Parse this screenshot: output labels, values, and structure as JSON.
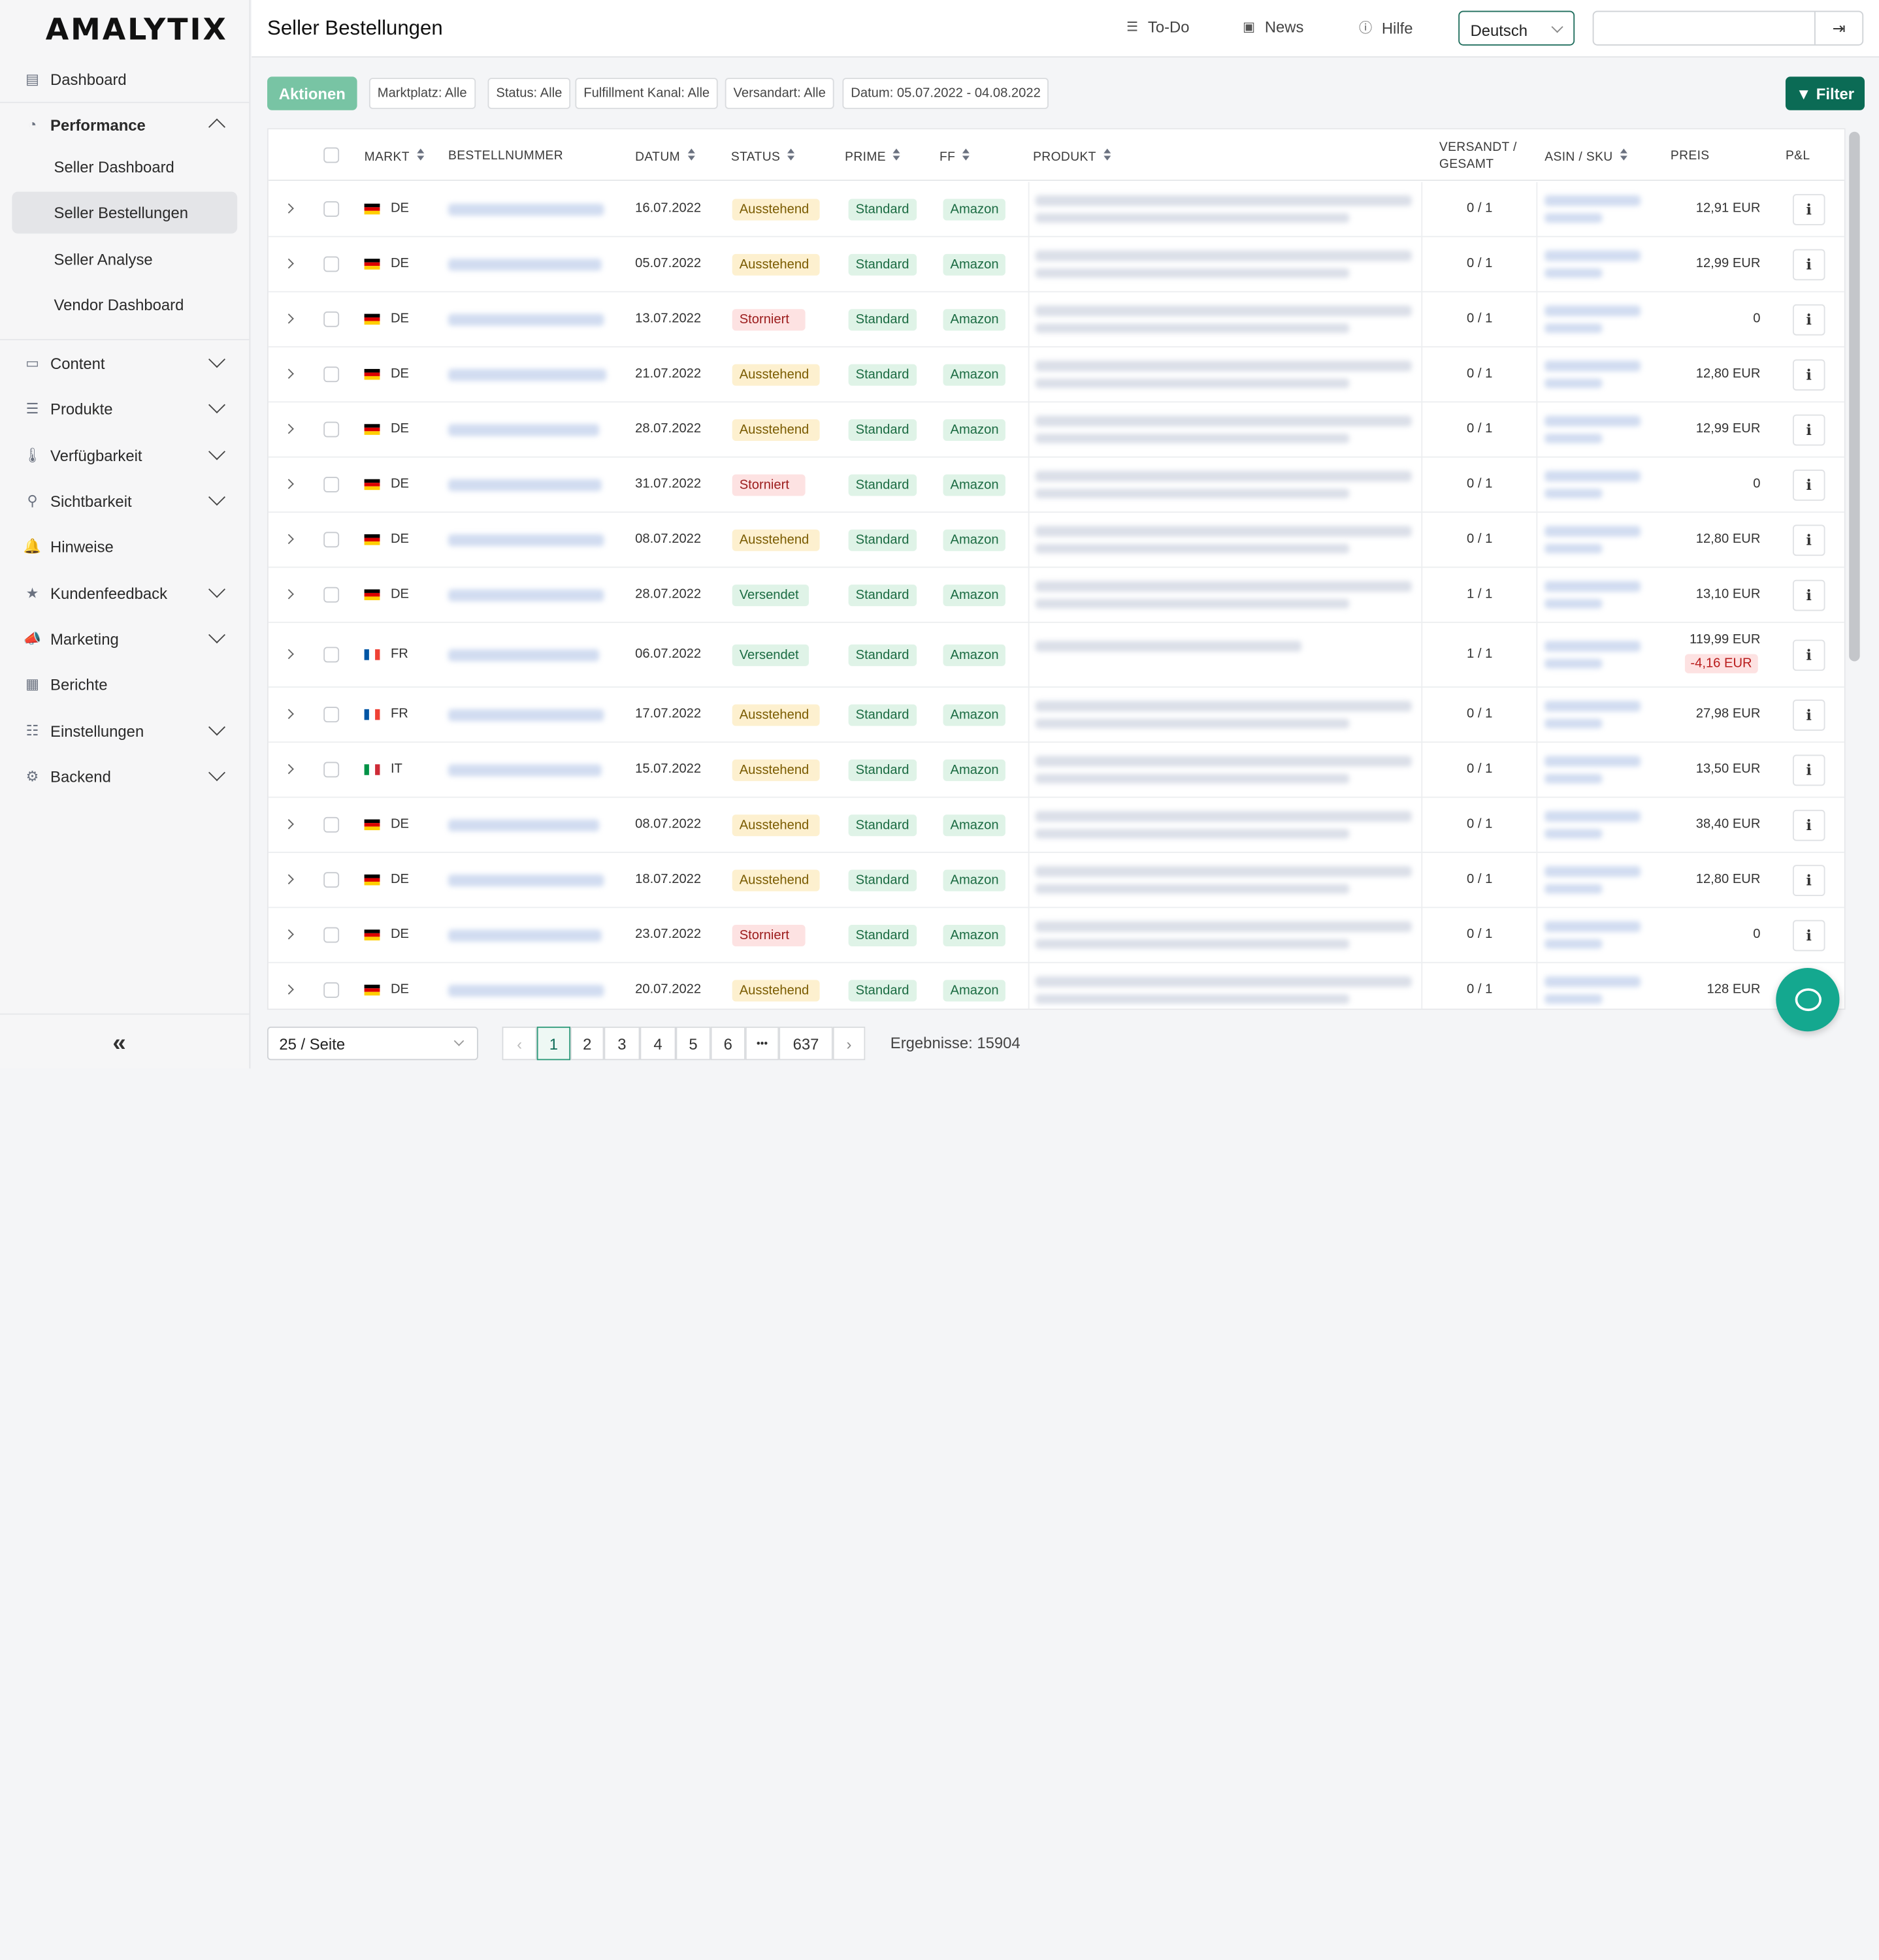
{
  "app": {
    "logo": "AMALYTIX"
  },
  "sidebar": {
    "items": [
      {
        "label": "Dashboard",
        "icon": "dashboard-icon"
      },
      {
        "label": "Performance",
        "icon": "performance-icon"
      },
      {
        "label": "Content",
        "icon": "content-icon"
      },
      {
        "label": "Produkte",
        "icon": "list-icon"
      },
      {
        "label": "Verfügbarkeit",
        "icon": "thermometer-icon"
      },
      {
        "label": "Sichtbarkeit",
        "icon": "search-icon"
      },
      {
        "label": "Hinweise",
        "icon": "bell-icon"
      },
      {
        "label": "Kundenfeedback",
        "icon": "star-icon"
      },
      {
        "label": "Marketing",
        "icon": "megaphone-icon"
      },
      {
        "label": "Berichte",
        "icon": "table-icon"
      },
      {
        "label": "Einstellungen",
        "icon": "sliders-icon"
      },
      {
        "label": "Backend",
        "icon": "gears-icon"
      }
    ],
    "performance_sub": [
      "Seller Dashboard",
      "Seller Bestellungen",
      "Seller Analyse",
      "Vendor Dashboard"
    ],
    "collapse": "«"
  },
  "header": {
    "title": "Seller Bestellungen",
    "todo": "To-Do",
    "news": "News",
    "help": "Hilfe",
    "language": "Deutsch",
    "search_value": ""
  },
  "toolbar": {
    "actions": "Aktionen",
    "chips": [
      "Marktplatz: Alle",
      "Status: Alle",
      "Fulfillment Kanal: Alle",
      "Versandart: Alle",
      "Datum: 05.07.2022 - 04.08.2022"
    ],
    "filter": "Filter"
  },
  "table": {
    "headers": {
      "markt": "MARKT",
      "bestellnummer": "BESTELLNUMMER",
      "datum": "DATUM",
      "status": "STATUS",
      "prime": "PRIME",
      "ff": "FF",
      "produkt": "PRODUKT",
      "versandt_1": "VERSANDT /",
      "versandt_2": "GESAMT",
      "asin": "ASIN / SKU",
      "preis": "PREIS",
      "pl": "P&L"
    },
    "rows": [
      {
        "markt": "DE",
        "datum": "16.07.2022",
        "status": "Ausstehend",
        "prime": "Standard",
        "ff": "Amazon",
        "versandt": "0 / 1",
        "preis": "12,91 EUR",
        "pl_icon": "i"
      },
      {
        "markt": "DE",
        "datum": "05.07.2022",
        "status": "Ausstehend",
        "prime": "Standard",
        "ff": "Amazon",
        "versandt": "0 / 1",
        "preis": "12,99 EUR",
        "pl_icon": "i"
      },
      {
        "markt": "DE",
        "datum": "13.07.2022",
        "status": "Storniert",
        "prime": "Standard",
        "ff": "Amazon",
        "versandt": "0 / 1",
        "preis": "0",
        "pl_icon": "i"
      },
      {
        "markt": "DE",
        "datum": "21.07.2022",
        "status": "Ausstehend",
        "prime": "Standard",
        "ff": "Amazon",
        "versandt": "0 / 1",
        "preis": "12,80 EUR",
        "pl_icon": "i"
      },
      {
        "markt": "DE",
        "datum": "28.07.2022",
        "status": "Ausstehend",
        "prime": "Standard",
        "ff": "Amazon",
        "versandt": "0 / 1",
        "preis": "12,99 EUR",
        "pl_icon": "i"
      },
      {
        "markt": "DE",
        "datum": "31.07.2022",
        "status": "Storniert",
        "prime": "Standard",
        "ff": "Amazon",
        "versandt": "0 / 1",
        "preis": "0",
        "pl_icon": "i"
      },
      {
        "markt": "DE",
        "datum": "08.07.2022",
        "status": "Ausstehend",
        "prime": "Standard",
        "ff": "Amazon",
        "versandt": "0 / 1",
        "preis": "12,80 EUR",
        "pl_icon": "i"
      },
      {
        "markt": "DE",
        "datum": "28.07.2022",
        "status": "Versendet",
        "prime": "Standard",
        "ff": "Amazon",
        "versandt": "1 / 1",
        "preis": "13,10 EUR",
        "pl_icon": "i"
      },
      {
        "markt": "FR",
        "datum": "06.07.2022",
        "status": "Versendet",
        "prime": "Standard",
        "ff": "Amazon",
        "versandt": "1 / 1",
        "preis": "119,99 EUR",
        "preis_neg": "-4,16 EUR",
        "pl_icon": "i"
      },
      {
        "markt": "FR",
        "datum": "17.07.2022",
        "status": "Ausstehend",
        "prime": "Standard",
        "ff": "Amazon",
        "versandt": "0 / 1",
        "preis": "27,98 EUR",
        "pl_icon": "i"
      },
      {
        "markt": "IT",
        "datum": "15.07.2022",
        "status": "Ausstehend",
        "prime": "Standard",
        "ff": "Amazon",
        "versandt": "0 / 1",
        "preis": "13,50 EUR",
        "pl_icon": "i"
      },
      {
        "markt": "DE",
        "datum": "08.07.2022",
        "status": "Ausstehend",
        "prime": "Standard",
        "ff": "Amazon",
        "versandt": "0 / 1",
        "preis": "38,40 EUR",
        "pl_icon": "i"
      },
      {
        "markt": "DE",
        "datum": "18.07.2022",
        "status": "Ausstehend",
        "prime": "Standard",
        "ff": "Amazon",
        "versandt": "0 / 1",
        "preis": "12,80 EUR",
        "pl_icon": "i"
      },
      {
        "markt": "DE",
        "datum": "23.07.2022",
        "status": "Storniert",
        "prime": "Standard",
        "ff": "Amazon",
        "versandt": "0 / 1",
        "preis": "0",
        "pl_icon": "i"
      },
      {
        "markt": "DE",
        "datum": "20.07.2022",
        "status": "Ausstehend",
        "prime": "Standard",
        "ff": "Amazon",
        "versandt": "0 / 1",
        "preis": "128 EUR",
        "pl_icon": "i"
      }
    ]
  },
  "footer": {
    "per_page": "25 / Seite",
    "pages": [
      "1",
      "2",
      "3",
      "4",
      "5",
      "6",
      "•••",
      "637"
    ],
    "prev": "‹",
    "next": "›",
    "results": "Ergebnisse: 15904"
  },
  "colors": {
    "accent": "#0b6b55",
    "actions": "#78c4a4",
    "chat": "#14a88f"
  }
}
